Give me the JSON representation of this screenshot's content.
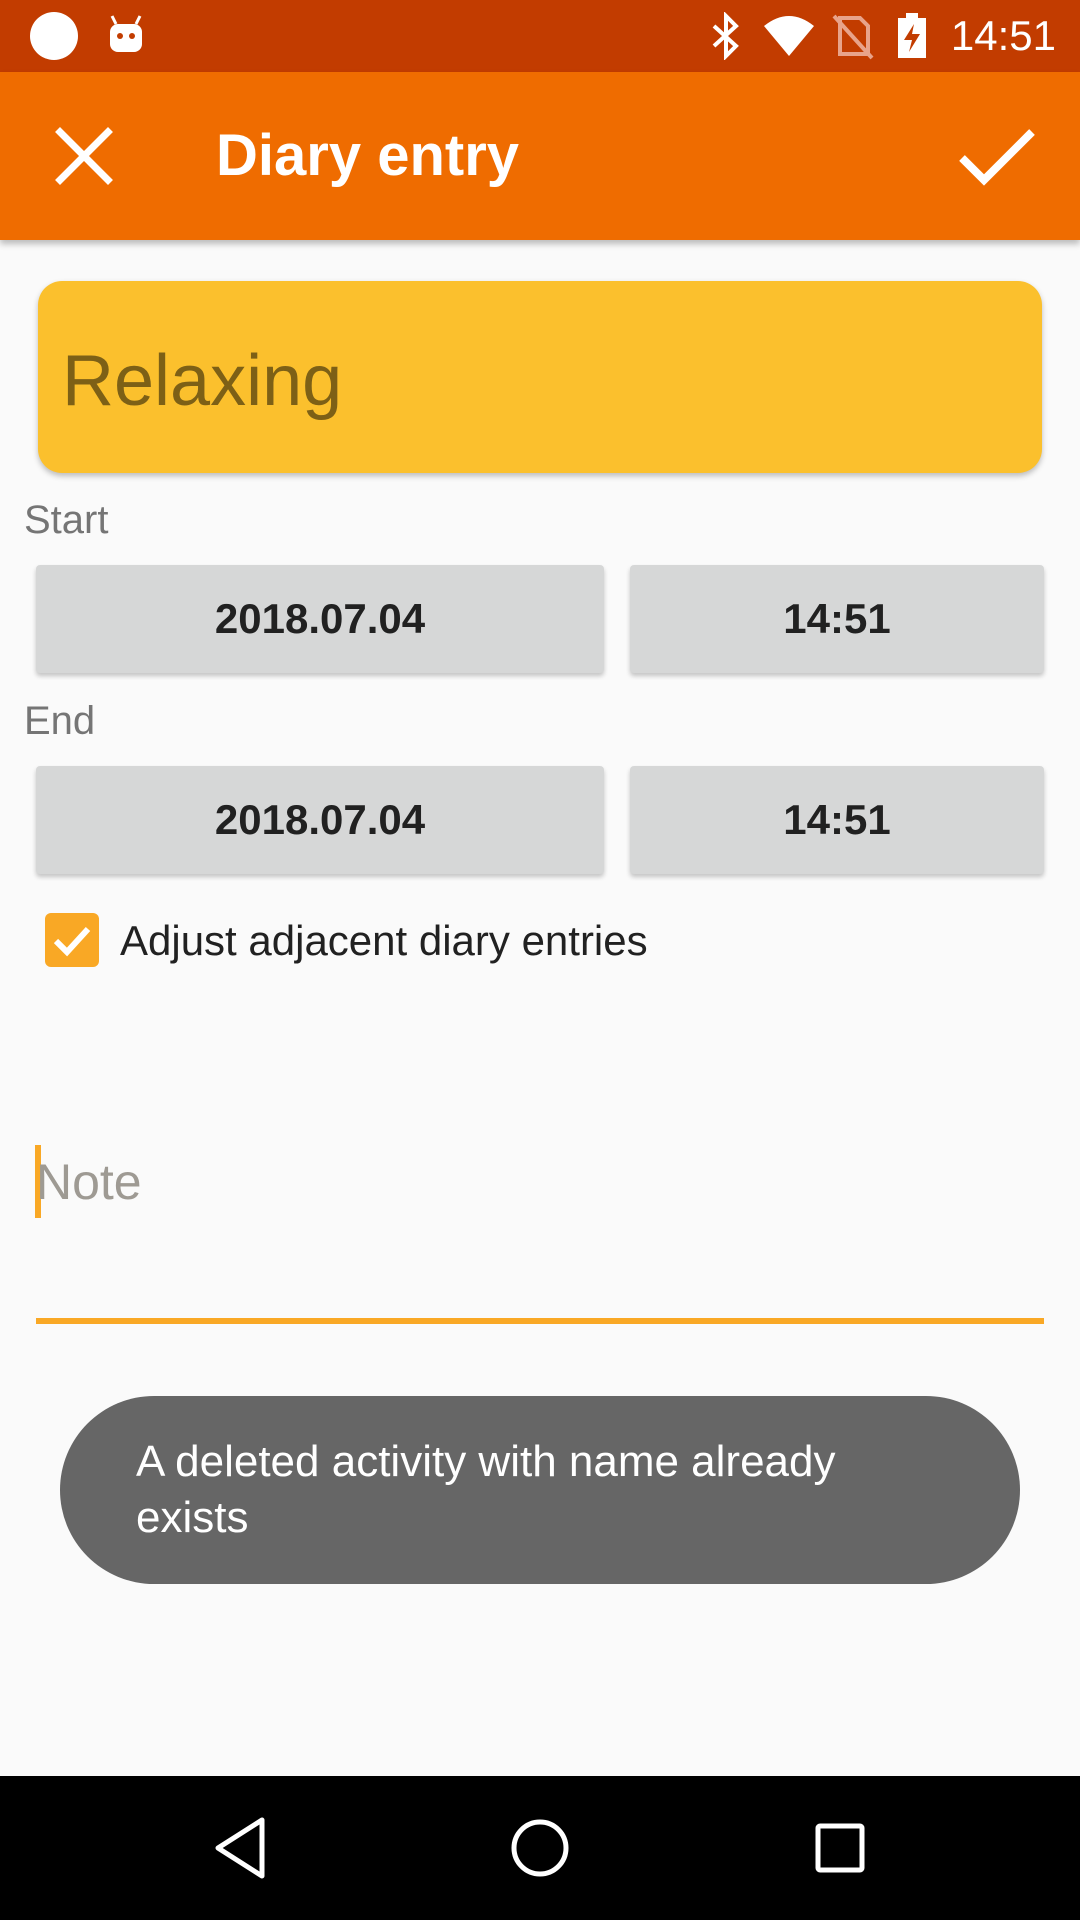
{
  "status_bar": {
    "time": "14:51",
    "icons": [
      "circle-notification-icon",
      "android-icon",
      "bluetooth-icon",
      "wifi-icon",
      "no-sim-icon",
      "battery-charging-icon"
    ],
    "background": "#c23c00"
  },
  "app_bar": {
    "title": "Diary entry",
    "close_icon": "close-icon",
    "confirm_icon": "check-icon",
    "background": "#ef6c00"
  },
  "activity": {
    "name": "Relaxing",
    "color": "#fbc02d"
  },
  "start": {
    "label": "Start",
    "date": "2018.07.04",
    "time": "14:51"
  },
  "end": {
    "label": "End",
    "date": "2018.07.04",
    "time": "14:51"
  },
  "adjust_adjacent": {
    "label": "Adjust adjacent diary entries",
    "checked": true
  },
  "note": {
    "placeholder": "Note",
    "value": ""
  },
  "toast": {
    "message": "A deleted activity with name  already exists"
  },
  "nav_bar": {
    "icons": [
      "back-icon",
      "home-icon",
      "recents-icon"
    ]
  }
}
